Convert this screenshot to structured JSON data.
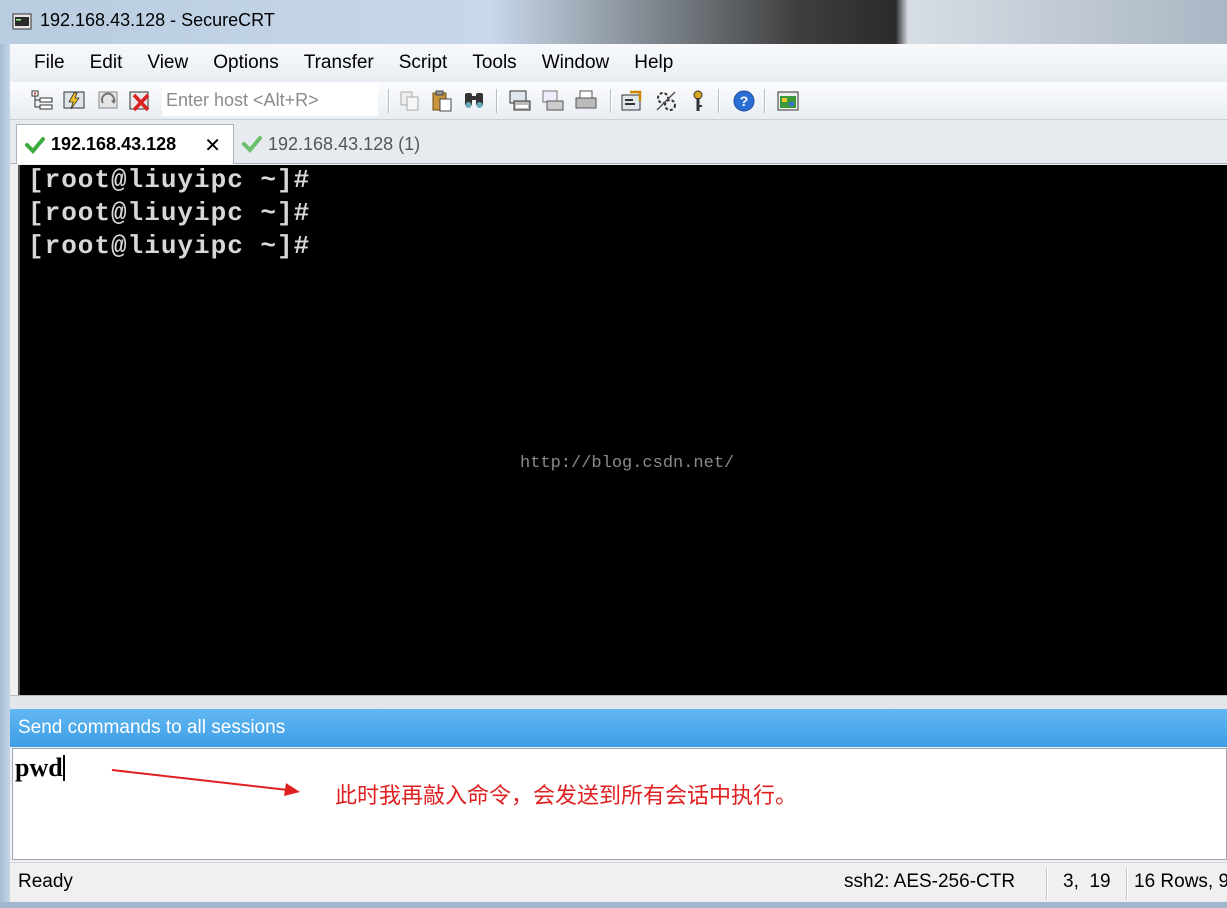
{
  "window": {
    "title": "192.168.43.128 - SecureCRT",
    "app_icon": "securecrt-app-icon"
  },
  "menubar": {
    "items": [
      "File",
      "Edit",
      "View",
      "Options",
      "Transfer",
      "Script",
      "Tools",
      "Window",
      "Help"
    ]
  },
  "toolbar": {
    "host_placeholder": "Enter host <Alt+R>",
    "icons": [
      "connect-icon",
      "quick-connect-icon",
      "reconnect-icon",
      "disconnect-icon",
      "copy-icon",
      "paste-icon",
      "find-icon",
      "print-screen-icon",
      "print-selection-icon",
      "print-icon",
      "session-options-icon",
      "global-options-icon",
      "keymap-icon",
      "help-icon",
      "sftp-icon"
    ]
  },
  "tabs": [
    {
      "label": "192.168.43.128",
      "active": true,
      "status_icon": "check-icon"
    },
    {
      "label": "192.168.43.128 (1)",
      "active": false,
      "status_icon": "check-icon"
    }
  ],
  "terminal": {
    "lines": [
      "[root@liuyipc ~]#",
      "[root@liuyipc ~]#",
      "[root@liuyipc ~]#"
    ],
    "watermark": "http://blog.csdn.net/"
  },
  "command_window": {
    "title": "Send commands to all sessions",
    "input_value": "pwd",
    "annotation": "此时我再敲入命令，会发送到所有会话中执行。",
    "annotation_color": "#e02020"
  },
  "statusbar": {
    "state": "Ready",
    "protocol": "ssh2: AES-256-CTR",
    "cursor_pos": "3,  19",
    "size": "16 Rows, 9"
  },
  "colors": {
    "accent": "#3e9de6",
    "terminal_bg": "#000000",
    "terminal_fg": "#d8d8d8",
    "check_green": "#3caa3c"
  }
}
